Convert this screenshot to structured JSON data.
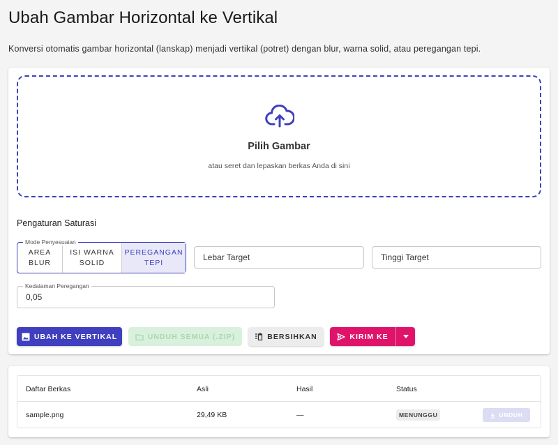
{
  "page": {
    "title": "Ubah Gambar Horizontal ke Vertikal",
    "description": "Konversi otomatis gambar horizontal (lanskap) menjadi vertikal (potret) dengan blur, warna solid, atau peregangan tepi."
  },
  "dropzone": {
    "title": "Pilih Gambar",
    "hint": "atau seret dan lepaskan berkas Anda di sini",
    "icon": "cloud-upload-icon"
  },
  "settings": {
    "section_label": "Pengaturan Saturasi",
    "mode_legend": "Mode Penyesuaian",
    "modes": [
      {
        "line1": "AREA",
        "line2": "BLUR",
        "active": false
      },
      {
        "line1": "ISI WARNA",
        "line2": "SOLID",
        "active": false
      },
      {
        "line1": "PEREGANGAN",
        "line2": "TEPI",
        "active": true
      }
    ],
    "width_placeholder": "Lebar Target",
    "height_placeholder": "Tinggi Target",
    "depth_legend": "Kedalaman Peregangan",
    "depth_value": "0,05"
  },
  "actions": {
    "convert_label": "UBAH KE VERTIKAL",
    "download_all_label": "UNDUH SEMUA (.ZIP)",
    "clear_label": "BERSIHKAN",
    "send_label": "KIRIM KE"
  },
  "files": {
    "headers": {
      "name": "Daftar Berkas",
      "original": "Asli",
      "result": "Hasil",
      "status": "Status"
    },
    "rows": [
      {
        "name": "sample.png",
        "original": "29,49 KB",
        "result": "—",
        "status": "MENUNGGU",
        "download_label": "UNDUH"
      }
    ]
  },
  "colors": {
    "primary": "#3f3fbf",
    "accent": "#e0136a",
    "success_disabled": "#d8f0dc"
  }
}
